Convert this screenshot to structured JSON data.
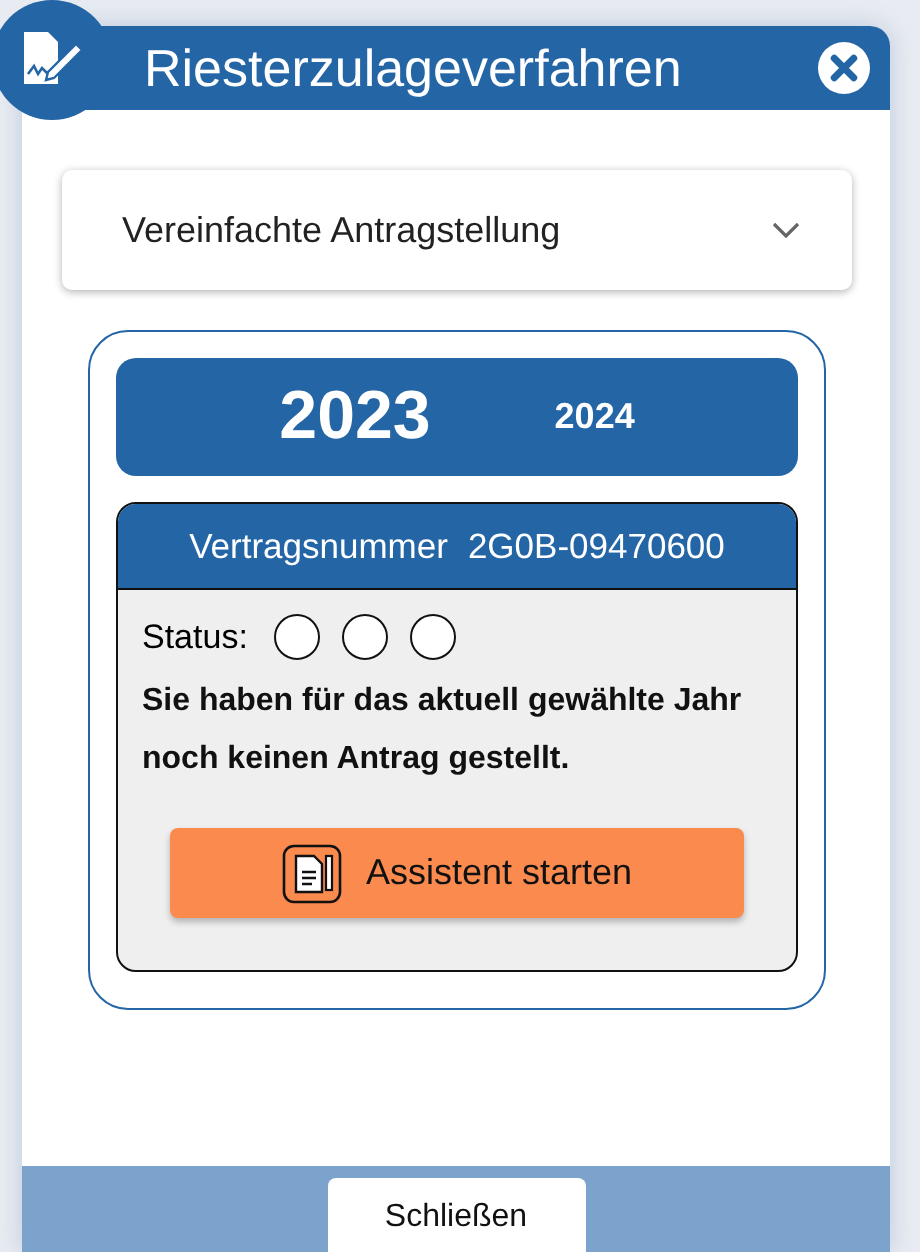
{
  "dialog": {
    "title": "Riesterzulageverfahren"
  },
  "dropdown": {
    "value": "Vereinfachte Antragstellung",
    "expanded": false
  },
  "years": [
    {
      "label": "2023",
      "selected": true
    },
    {
      "label": "2024",
      "selected": false
    }
  ],
  "contract": {
    "label": "Vertragsnummer",
    "number": "2G0B-09470600"
  },
  "status": {
    "label": "Status:",
    "lights": [
      {
        "on": false
      },
      {
        "on": false
      },
      {
        "on": false
      }
    ]
  },
  "message": "Sie haben für das aktuell gewählte Jahr noch keinen Antrag gestellt.",
  "assistant_button": "Assistent starten",
  "close_button": "Schließen"
}
